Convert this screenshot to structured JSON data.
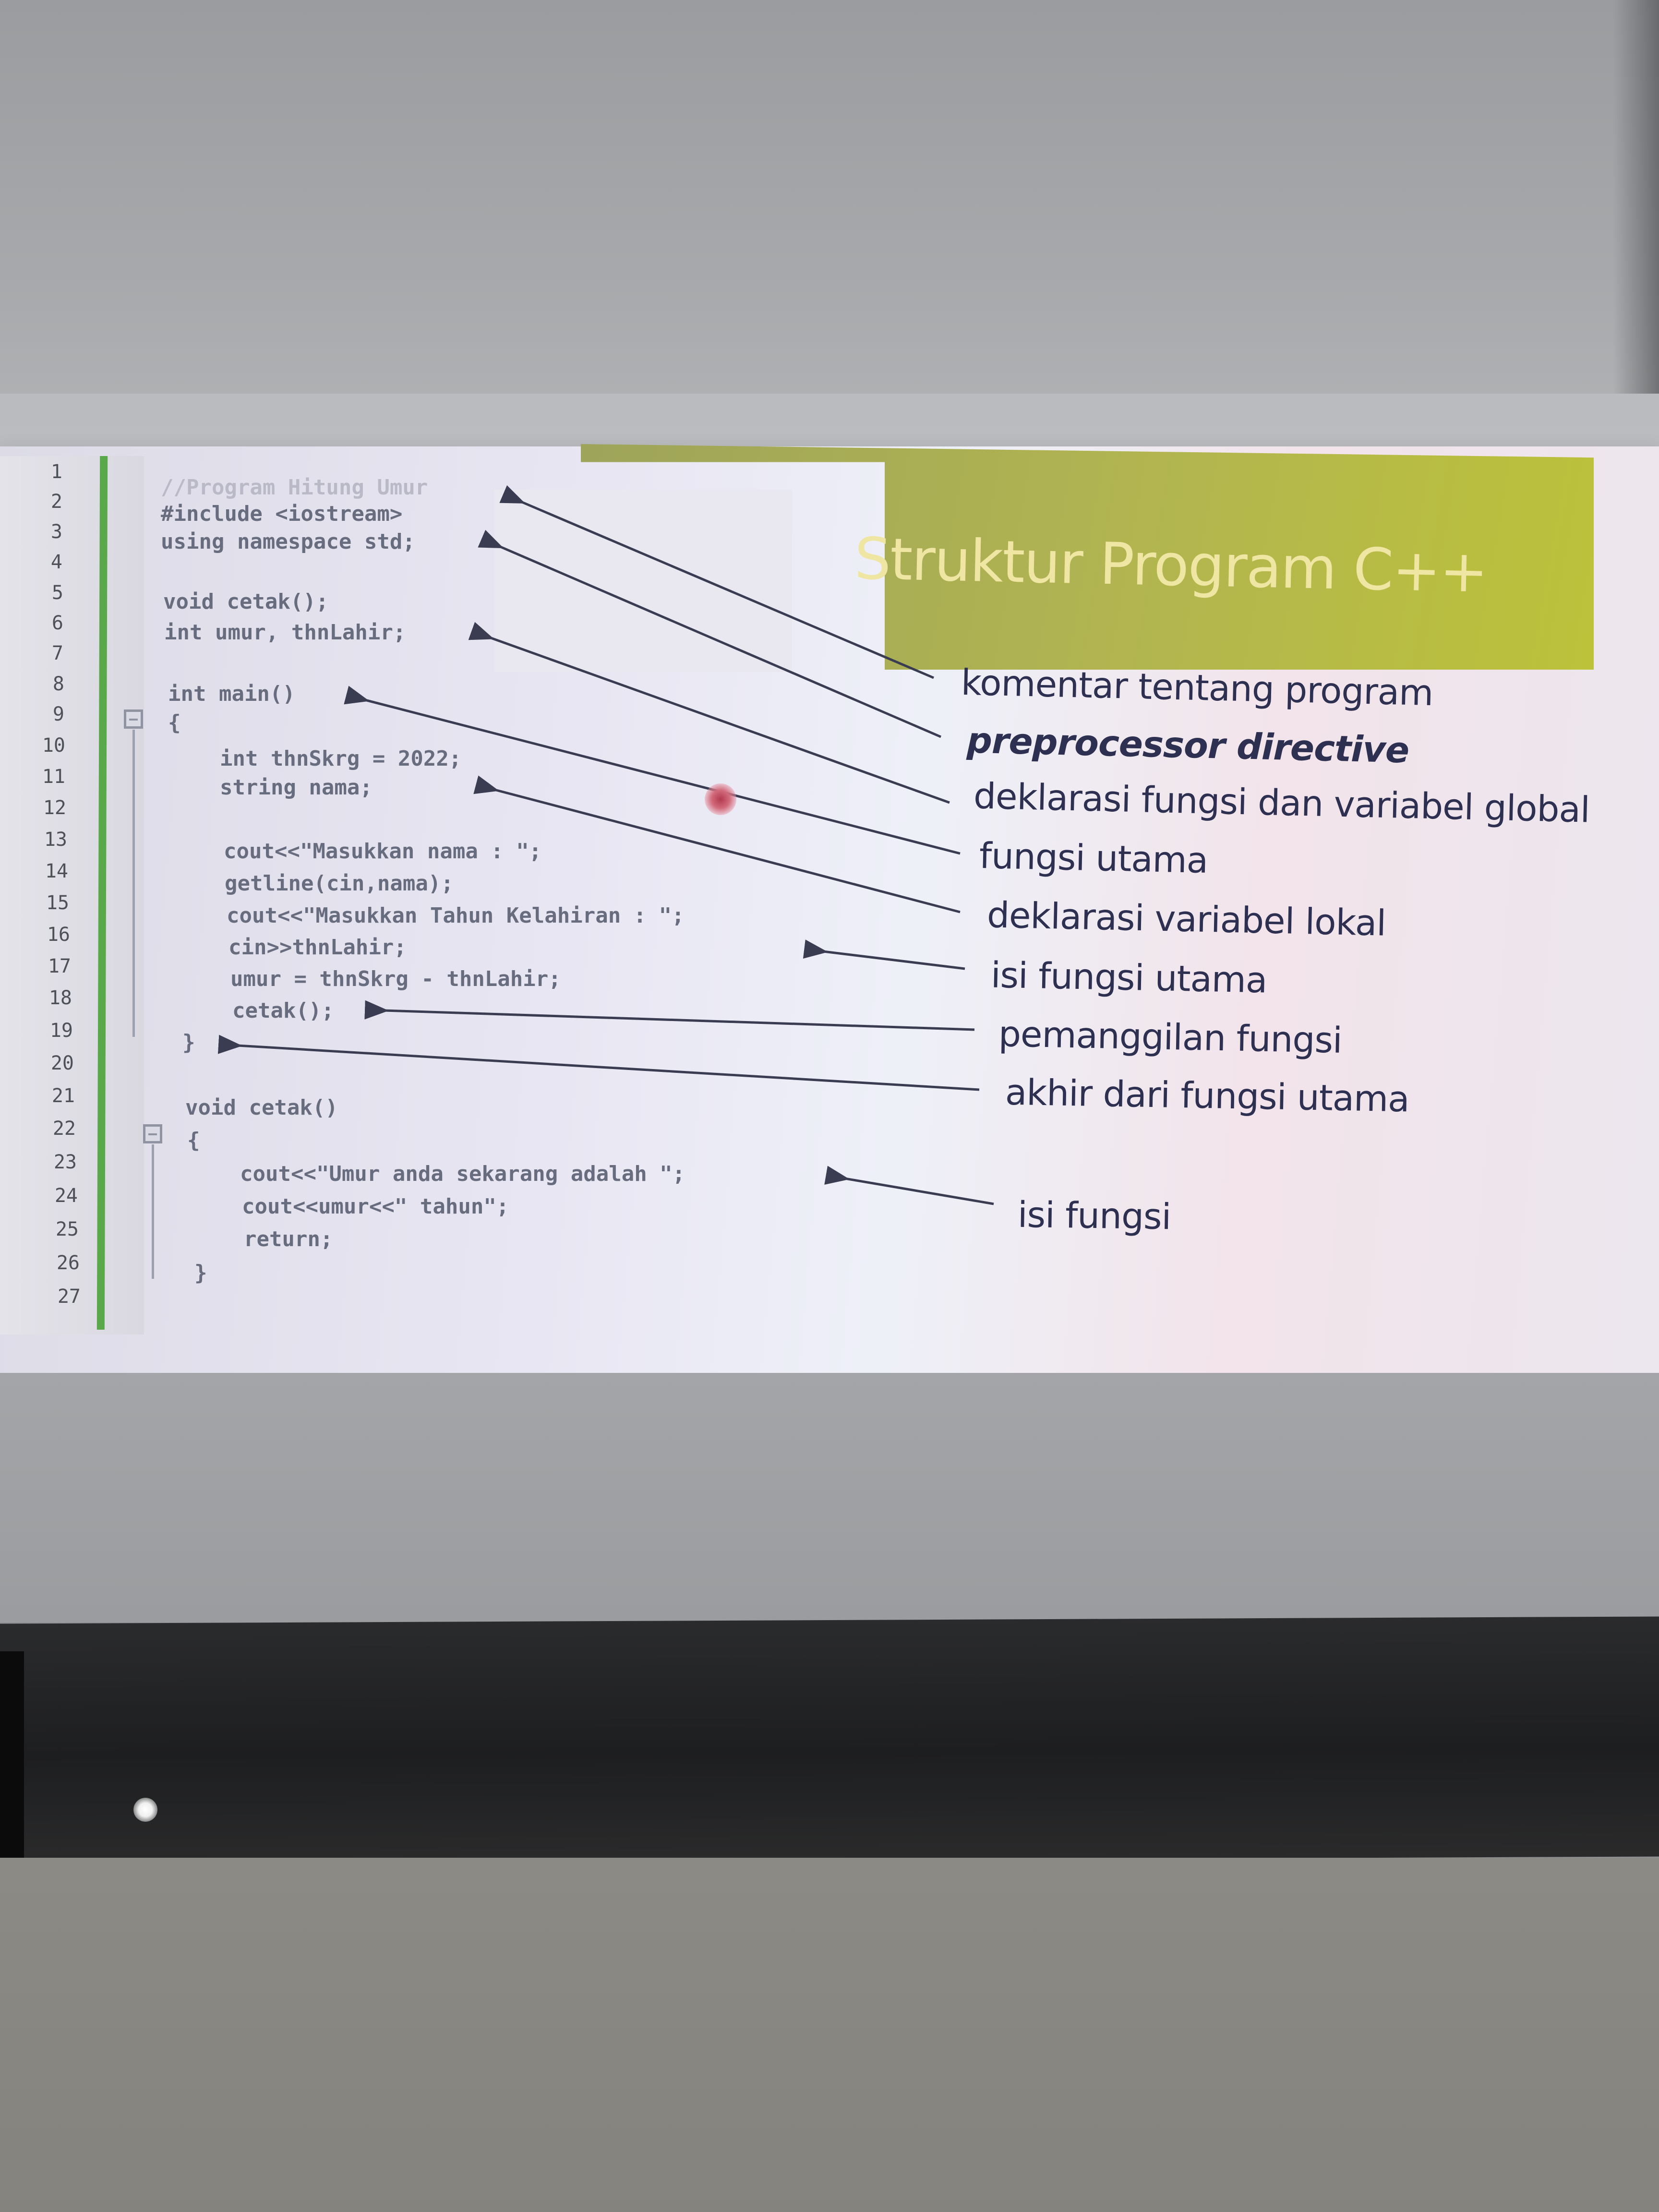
{
  "slide": {
    "title": "Struktur Program C++",
    "line_numbers": [
      "1",
      "2",
      "3",
      "4",
      "5",
      "6",
      "7",
      "8",
      "9",
      "10",
      "11",
      "12",
      "13",
      "14",
      "15",
      "16",
      "17",
      "18",
      "19",
      "20",
      "21",
      "22",
      "23",
      "24",
      "25",
      "26",
      "27"
    ],
    "code": [
      "//Program Hitung Umur",
      "#include <iostream>",
      "using namespace std;",
      "void cetak();",
      "int umur, thnLahir;",
      "int main()",
      "{",
      "int thnSkrg = 2022;",
      "string nama;",
      "cout<<\"Masukkan nama : \";",
      "getline(cin,nama);",
      "cout<<\"Masukkan Tahun Kelahiran : \";",
      "cin>>thnLahir;",
      "umur = thnSkrg - thnLahir;",
      "cetak();",
      "}",
      "void cetak()",
      "{",
      "cout<<\"Umur anda sekarang adalah \";",
      "cout<<umur<<\" tahun\";",
      "return;",
      "}"
    ],
    "labels": [
      "komentar tentang program",
      "preprocessor directive",
      "deklarasi fungsi dan variabel global",
      "fungsi utama",
      "deklarasi variabel lokal",
      "isi fungsi utama",
      "pemanggilan fungsi",
      "akhir dari fungsi utama",
      "isi fungsi"
    ],
    "colors": {
      "title_banner": "#b2b550",
      "title_text": "#f0e6a4",
      "gutter_marker": "#59a84a",
      "label_text": "#2d3050",
      "code_text": "#676c7e"
    }
  }
}
